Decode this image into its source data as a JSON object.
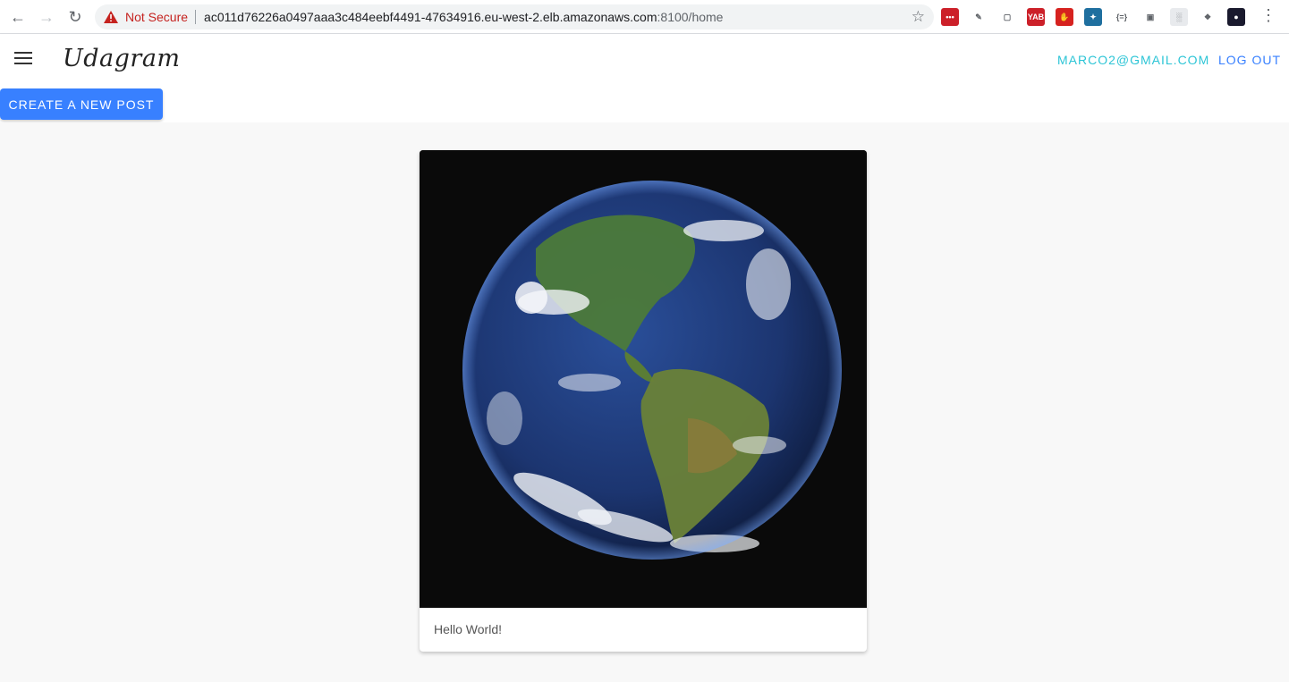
{
  "browser": {
    "security_label": "Not Secure",
    "url_host": "ac011d76226a0497aaa3c484eebf4491-47634916.eu-west-2.elb.amazonaws.com",
    "url_rest": ":8100/home",
    "extensions": [
      {
        "name": "lastpass-icon",
        "color": "#cc2029",
        "glyph": "•••"
      },
      {
        "name": "colorpicker-icon",
        "color": "#ffffff",
        "glyph": "✎"
      },
      {
        "name": "screenshot-icon",
        "color": "#ffffff",
        "glyph": "▢"
      },
      {
        "name": "yab-icon",
        "color": "#cc2029",
        "glyph": "YAB"
      },
      {
        "name": "adblock-icon",
        "color": "#d6221f",
        "glyph": "✋"
      },
      {
        "name": "crosshair-icon",
        "color": "#1f6f9f",
        "glyph": "✦"
      },
      {
        "name": "json-icon",
        "color": "#ffffff",
        "glyph": "{=}"
      },
      {
        "name": "image-icon",
        "color": "#ffffff",
        "glyph": "▣"
      },
      {
        "name": "grid-icon",
        "color": "#e8eaed",
        "glyph": "░"
      },
      {
        "name": "puzzle-icon",
        "color": "#ffffff",
        "glyph": "❖"
      },
      {
        "name": "profile-icon",
        "color": "#1a1a2e",
        "glyph": "●"
      }
    ]
  },
  "app": {
    "brand": "Udagram",
    "user_email": "marco2@gmail.com",
    "logout_label": "Log Out",
    "create_label": "Create a new post"
  },
  "feed": {
    "posts": [
      {
        "caption": "Hello World!",
        "image": "earth-photo"
      }
    ]
  },
  "colors": {
    "primary": "#3880ff",
    "secondary": "#2dc5d6"
  }
}
